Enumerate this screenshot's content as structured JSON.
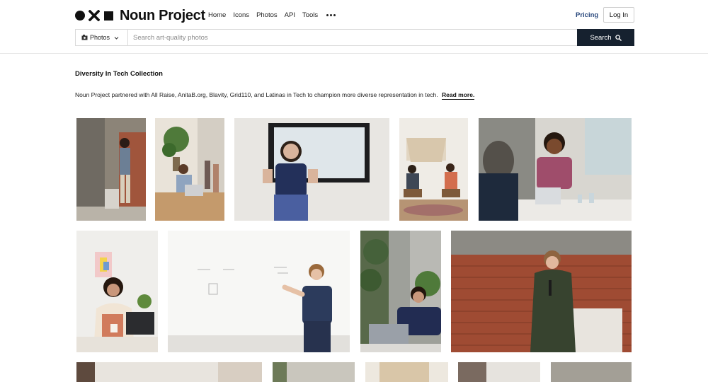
{
  "header": {
    "brand": "Noun Project",
    "nav": [
      "Home",
      "Icons",
      "Photos",
      "API",
      "Tools"
    ],
    "pricing": "Pricing",
    "login": "Log In"
  },
  "search": {
    "type_label": "Photos",
    "placeholder": "Search art-quality photos",
    "button_label": "Search"
  },
  "collection": {
    "title": "Diversity In Tech Collection",
    "description": "Noun Project partnered with All Raise, AnitaB.org, Blavity, Grid110, and Latinas in Tech to champion more diverse representation in tech.",
    "read_more": "Read more."
  },
  "colors": {
    "search_button_bg": "#16212f",
    "pricing_link": "#2b4a7e"
  },
  "photos_row1": [
    "man-standing-with-tablet",
    "man-at-laptop-with-plant",
    "woman-presenting-before-screen",
    "two-women-seated-talking",
    "man-smiling-in-meeting"
  ],
  "photos_row2": [
    "woman-with-laptop-and-mug",
    "man-at-whiteboard",
    "woman-working-on-laptop",
    "person-speaking-with-microphone"
  ]
}
